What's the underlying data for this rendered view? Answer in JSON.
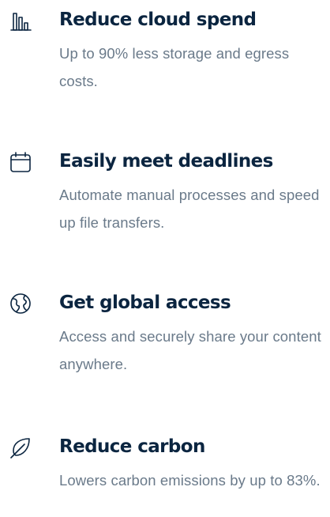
{
  "features": [
    {
      "icon": "bar-chart-icon",
      "title": "Reduce cloud spend",
      "description": "Up to 90% less storage and egress costs."
    },
    {
      "icon": "calendar-icon",
      "title": "Easily meet deadlines",
      "description": "Automate manual processes and speed up file transfers."
    },
    {
      "icon": "globe-icon",
      "title": "Get global access",
      "description": "Access and securely share your content anywhere."
    },
    {
      "icon": "leaf-icon",
      "title": "Reduce carbon",
      "description": "Lowers carbon emissions by up to 83%."
    }
  ],
  "colors": {
    "heading": "#0b2540",
    "body_text": "#6a7a8a",
    "icon_stroke": "#0b2540",
    "background": "#ffffff"
  }
}
